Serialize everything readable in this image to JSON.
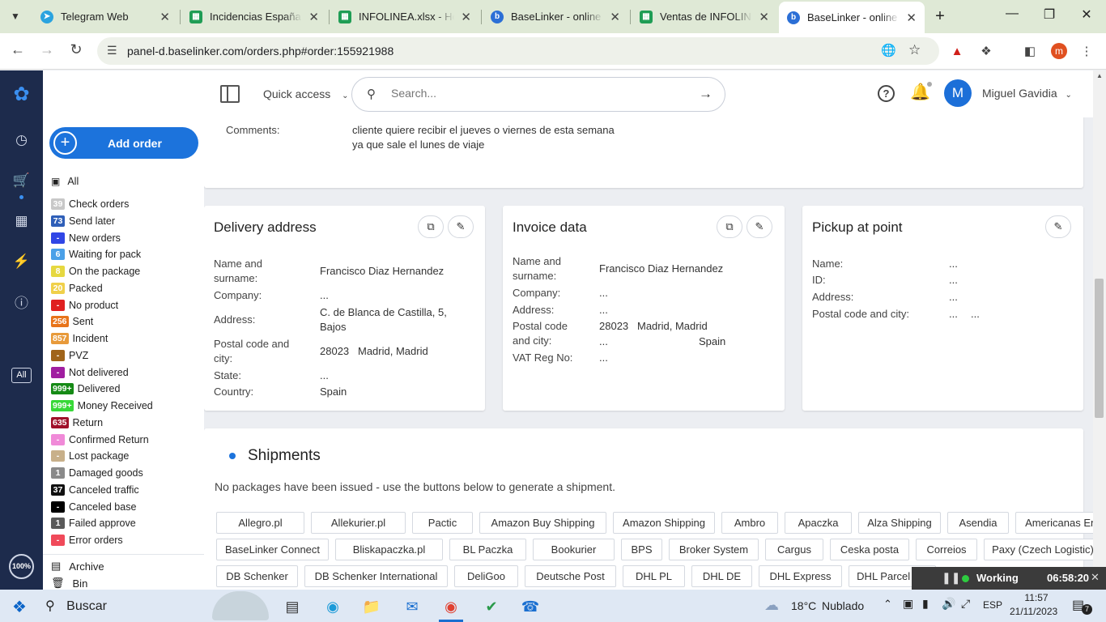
{
  "browser": {
    "tabs": [
      {
        "title": "Telegram Web",
        "icon": "telegram-icon",
        "color": "#2aa3df"
      },
      {
        "title": "Incidencias España -",
        "icon": "sheets-icon",
        "color": "#1f9d55"
      },
      {
        "title": "INFOLINEA.xlsx - Hoj",
        "icon": "sheets-icon",
        "color": "#1f9d55"
      },
      {
        "title": "BaseLinker - online s",
        "icon": "baselinker-icon",
        "color": "#2b6fd6"
      },
      {
        "title": "Ventas de INFOLINEA",
        "icon": "sheets-icon",
        "color": "#1f9d55"
      },
      {
        "title": "BaseLinker - online s",
        "icon": "baselinker-icon",
        "color": "#2b6fd6"
      }
    ],
    "url": "panel-d.baselinker.com/orders.php#order:155921988",
    "profile_initial": "m"
  },
  "topbar": {
    "quick_access": "Quick access",
    "search_placeholder": "Search...",
    "avatar_initial": "M",
    "user_name": "Miguel Gavidia"
  },
  "sidebar": {
    "add_order": "Add order",
    "all_label": "All",
    "statuses": [
      {
        "count": "39",
        "label": "Check orders",
        "color": "#c8c8c8"
      },
      {
        "count": "73",
        "label": "Send later",
        "color": "#2f5fb8"
      },
      {
        "count": "-",
        "label": "New orders",
        "color": "#3046e6"
      },
      {
        "count": "6",
        "label": "Waiting for pack",
        "color": "#4aa0e8"
      },
      {
        "count": "8",
        "label": "On the package",
        "color": "#e6d840"
      },
      {
        "count": "20",
        "label": "Packed",
        "color": "#f0d04a"
      },
      {
        "count": "-",
        "label": "No product",
        "color": "#e02020"
      },
      {
        "count": "256",
        "label": "Sent",
        "color": "#e8741a"
      },
      {
        "count": "857",
        "label": "Incident",
        "color": "#e89a3a"
      },
      {
        "count": "-",
        "label": "PVZ",
        "color": "#a0641a"
      },
      {
        "count": "-",
        "label": "Not delivered",
        "color": "#a01ea0"
      },
      {
        "count": "999+",
        "label": "Delivered",
        "color": "#158a15"
      },
      {
        "count": "999+",
        "label": "Money Received",
        "color": "#38d838"
      },
      {
        "count": "635",
        "label": "Return",
        "color": "#a0102a"
      },
      {
        "count": "-",
        "label": "Confirmed Return",
        "color": "#f08ad8"
      },
      {
        "count": "-",
        "label": "Lost package",
        "color": "#c8b08a"
      },
      {
        "count": "1",
        "label": "Damaged goods",
        "color": "#8a8a8a"
      },
      {
        "count": "37",
        "label": "Canceled traffic",
        "color": "#111111"
      },
      {
        "count": "-",
        "label": "Canceled base",
        "color": "#000000"
      },
      {
        "count": "1",
        "label": "Failed approve",
        "color": "#5a5a5a"
      },
      {
        "count": "-",
        "label": "Error orders",
        "color": "#f04a5a"
      }
    ],
    "archive": "Archive",
    "bin": "Bin"
  },
  "leftnav": {
    "all_label": "All",
    "zoom": "100%"
  },
  "comments": {
    "label": "Comments:",
    "line1": "cliente quiere recibir el jueves o viernes de esta semana",
    "line2": "ya que sale el lunes de viaje"
  },
  "delivery": {
    "title": "Delivery address",
    "name_label": "Name and surname:",
    "name": "Francisco Diaz Hernandez",
    "company_label": "Company:",
    "company": "...",
    "address_label": "Address:",
    "address": "C. de Blanca de Castilla, 5, Bajos",
    "postal_label": "Postal code and city:",
    "postal": "28023   Madrid, Madrid",
    "state_label": "State:",
    "state": "...",
    "country_label": "Country:",
    "country": "Spain"
  },
  "invoice": {
    "title": "Invoice data",
    "name_label": "Name and surname:",
    "name": "Francisco Diaz Hernandez",
    "company_label": "Company:",
    "company": "...",
    "address_label": "Address:",
    "address": "...",
    "postal_label": "Postal code and city:",
    "postal": "28023   Madrid, Madrid",
    "city_extra": "...",
    "country": "Spain",
    "vat_label": "VAT Reg No:",
    "vat": "..."
  },
  "pickup": {
    "title": "Pickup at point",
    "name_label": "Name:",
    "name": "...",
    "id_label": "ID:",
    "id": "...",
    "address_label": "Address:",
    "address": "...",
    "postal_label": "Postal code and city:",
    "postal": "...",
    "city": "..."
  },
  "shipments": {
    "title": "Shipments",
    "empty": "No packages have been issued - use the buttons below to generate a shipment.",
    "row1": [
      "Allegro.pl",
      "Allekurier.pl",
      "Pactic",
      "Amazon Buy Shipping",
      "Amazon Shipping",
      "Ambro",
      "Apaczka",
      "Alza Shipping",
      "Asendia",
      "Americanas Entrega"
    ],
    "row2": [
      "BaseLinker Connect",
      "Bliskapaczka.pl",
      "BL Paczka",
      "Bookurier",
      "BPS",
      "Broker System",
      "Cargus",
      "Ceska posta",
      "Correios",
      "Paxy (Czech Logistic)"
    ],
    "row3": [
      "DB Schenker",
      "DB Schenker International",
      "DeliGoo",
      "Deutsche Post",
      "DHL PL",
      "DHL DE",
      "DHL Express",
      "DHL Parcel UK"
    ]
  },
  "working_widget": {
    "label": "Working",
    "time": "06:58:20"
  },
  "taskbar": {
    "search": "Buscar",
    "temp": "18°C",
    "weather": "Nublado",
    "lang": "ESP",
    "time": "11:57",
    "date": "21/11/2023",
    "notif_count": "7"
  }
}
